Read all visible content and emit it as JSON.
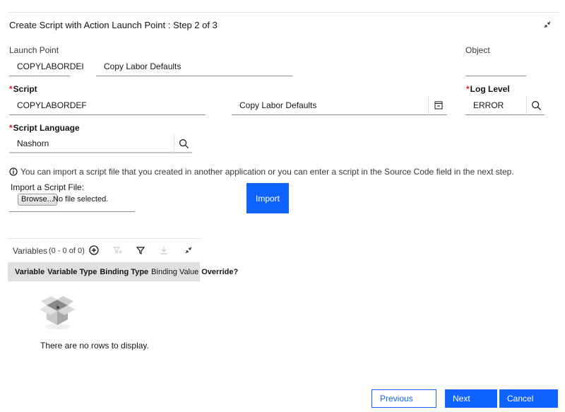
{
  "dialog": {
    "title": "Create Script with Action Launch Point : Step 2 of 3"
  },
  "launch_point": {
    "label": "Launch Point",
    "value": "COPYLABORDEI",
    "description": "Copy Labor Defaults"
  },
  "object": {
    "label": "Object",
    "value": ""
  },
  "script": {
    "required_mark": "*",
    "label": "Script",
    "value": "COPYLABORDEF",
    "description": "Copy Labor Defaults"
  },
  "log_level": {
    "required_mark": "*",
    "label": "Log Level",
    "value": "ERROR"
  },
  "script_language": {
    "required_mark": "*",
    "label": "Script Language",
    "value": "Nashorn"
  },
  "info": {
    "text": "You can import a script file that you created in another application or you can enter a script in the Source Code field in the next step."
  },
  "import": {
    "label": "Import a Script File:",
    "browse_label": "Browse...",
    "file_status": "No file selected.",
    "import_button": "Import"
  },
  "variables_table": {
    "title": "Variables",
    "count": "(0 - 0 of 0)",
    "columns": [
      "Variable",
      "Variable Type",
      "Binding Type",
      "Binding Value",
      "Override?"
    ],
    "empty_message": "There are no rows to display."
  },
  "footer": {
    "previous": "Previous",
    "next": "Next",
    "cancel": "Cancel"
  },
  "colors": {
    "primary": "#0f62fe",
    "required": "#da1e28"
  }
}
